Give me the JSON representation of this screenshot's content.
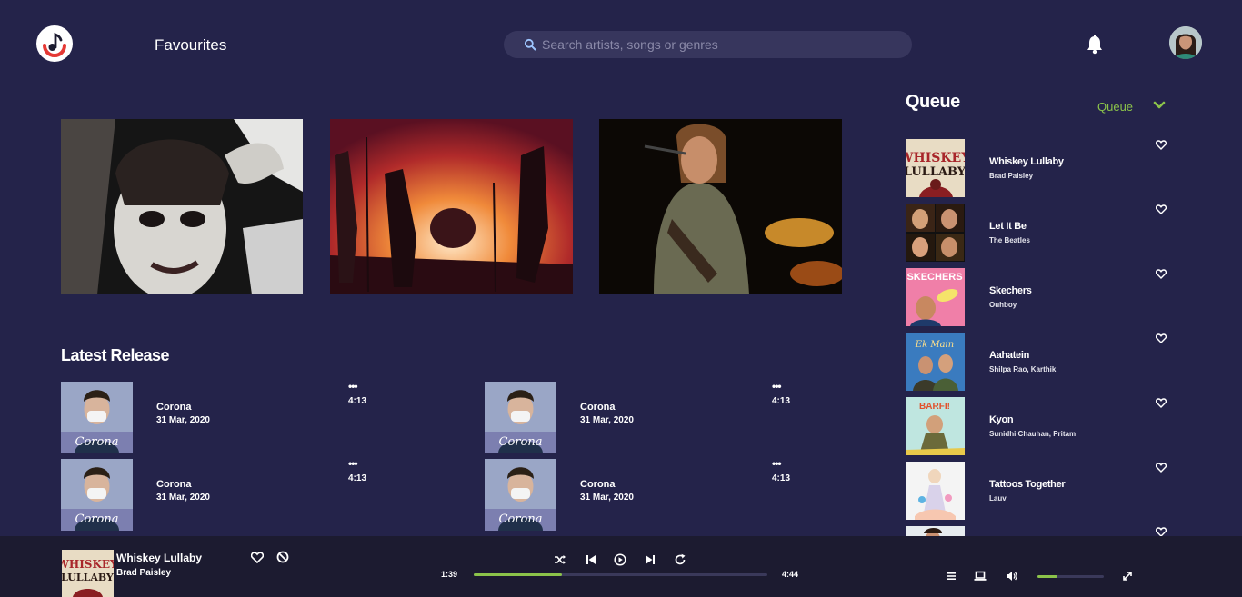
{
  "header": {
    "page_title": "Favourites",
    "search_placeholder": "Search artists, songs or genres"
  },
  "featured": [
    {
      "name": "featured-artist-1"
    },
    {
      "name": "featured-band-live"
    },
    {
      "name": "featured-artist-3"
    }
  ],
  "latest_release": {
    "title": "Latest Release",
    "items": [
      {
        "title": "Corona",
        "date": "31 Mar, 2020",
        "duration": "4:13",
        "more": "•••"
      },
      {
        "title": "Corona",
        "date": "31 Mar, 2020",
        "duration": "4:13",
        "more": "•••"
      },
      {
        "title": "Corona",
        "date": "31 Mar, 2020",
        "duration": "4:13",
        "more": "•••"
      },
      {
        "title": "Corona",
        "date": "31 Mar, 2020",
        "duration": "4:13",
        "more": "•••"
      }
    ]
  },
  "queue": {
    "title": "Queue",
    "dropdown_label": "Queue",
    "items": [
      {
        "title": "Whiskey Lullaby",
        "artist": "Brad Paisley"
      },
      {
        "title": "Let It Be",
        "artist": "The Beatles"
      },
      {
        "title": "Skechers",
        "artist": "Ouhboy"
      },
      {
        "title": "Aahatein",
        "artist": "Shilpa Rao, Karthik"
      },
      {
        "title": "Kyon",
        "artist": "Sunidhi Chauhan, Pritam"
      },
      {
        "title": "Tattoos Together",
        "artist": "Lauv"
      },
      {
        "title": "",
        "artist": ""
      }
    ]
  },
  "player": {
    "title": "Whiskey Lullaby",
    "artist": "Brad Paisley",
    "elapsed": "1:39",
    "total": "4:44",
    "progress": 0.3,
    "volume": 0.3
  },
  "colors": {
    "background": "#24234a",
    "accent": "#8bc34a",
    "player_bar": "#1c1b30",
    "search_bg": "#37365d",
    "logo_red": "#e53935"
  }
}
